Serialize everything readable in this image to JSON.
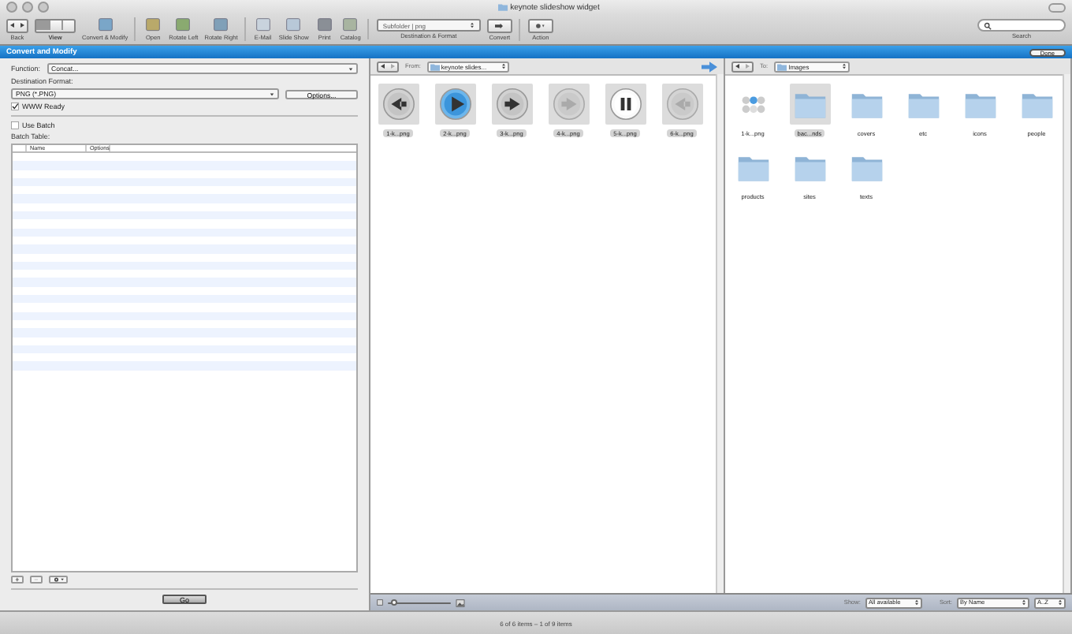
{
  "window": {
    "title": "keynote slideshow widget"
  },
  "toolbar": {
    "nav_label": "Back",
    "view_label": "View",
    "view_segments": [
      {
        "selected": true
      },
      {
        "selected": false
      },
      {
        "selected": false
      }
    ],
    "tools": [
      {
        "label": "Convert & Modify"
      },
      {
        "label": "Open"
      },
      {
        "label": "Rotate Left"
      },
      {
        "label": "Rotate Right"
      },
      {
        "label": "E-Mail"
      },
      {
        "label": "Slide Show"
      },
      {
        "label": "Print"
      },
      {
        "label": "Catalog"
      }
    ],
    "destination": {
      "value": "Subfolder | png",
      "label": "Destination & Format"
    },
    "convert_label": "Convert",
    "action_label": "Action",
    "search_label": "Search"
  },
  "header": {
    "title": "Convert and Modify",
    "done": "Done"
  },
  "form": {
    "function_label": "Function:",
    "function_value": "Concat...",
    "dest_label": "Destination Format:",
    "dest_value": "PNG (*.PNG)",
    "options": "Options...",
    "checks": [
      {
        "label": "WWW Ready",
        "checked": true
      },
      {
        "label": "Use Batch",
        "checked": false
      }
    ],
    "batch_label": "Batch Table:",
    "columns": [
      "Name",
      "Options"
    ],
    "add": "+",
    "remove": "−",
    "go": "Go"
  },
  "source": {
    "from_label": "From:",
    "path": "keynote slides...",
    "files": [
      {
        "name": "1-k...png",
        "kind": "back",
        "disabled": false,
        "selected": true
      },
      {
        "name": "2-k...png",
        "kind": "play",
        "disabled": false,
        "selected": true
      },
      {
        "name": "3-k...png",
        "kind": "forward",
        "disabled": false,
        "selected": true
      },
      {
        "name": "4-k...png",
        "kind": "forward",
        "disabled": true,
        "selected": true
      },
      {
        "name": "5-k...png",
        "kind": "pause",
        "disabled": false,
        "selected": true
      },
      {
        "name": "6-k...png",
        "kind": "back",
        "disabled": true,
        "selected": true
      }
    ]
  },
  "target": {
    "to_label": "To:",
    "path": "Images",
    "items": [
      {
        "name": "1-k...png",
        "kind": "image",
        "selected": false
      },
      {
        "name": "bac...nds",
        "kind": "folder",
        "selected": true
      },
      {
        "name": "covers",
        "kind": "folder",
        "selected": false
      },
      {
        "name": "etc",
        "kind": "folder",
        "selected": false
      },
      {
        "name": "icons",
        "kind": "folder",
        "selected": false
      },
      {
        "name": "people",
        "kind": "folder",
        "selected": false
      },
      {
        "name": "products",
        "kind": "folder",
        "selected": false
      },
      {
        "name": "sites",
        "kind": "folder",
        "selected": false
      },
      {
        "name": "texts",
        "kind": "folder",
        "selected": false
      }
    ]
  },
  "bottom": {
    "zoom": {
      "level": 0.05
    },
    "show_label": "Show:",
    "show_value": "All available",
    "sort_label": "Sort:",
    "sort_value": "By Name",
    "order": "A..Z"
  },
  "status_bar": "6 of 6 items – 1 of 9 items"
}
